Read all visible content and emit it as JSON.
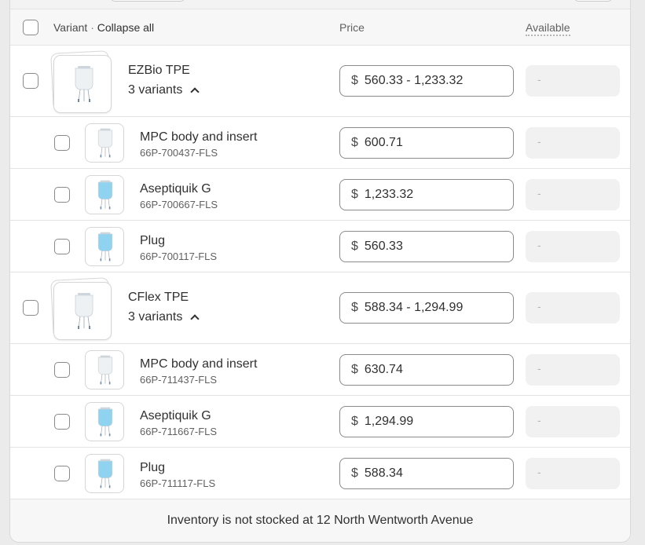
{
  "header": {
    "variant_label": "Variant",
    "separator": "·",
    "collapse_label": "Collapse all",
    "price_label": "Price",
    "available_label": "Available"
  },
  "groups": [
    {
      "name": "EZBio TPE",
      "variants_label": "3 variants",
      "price_currency": "$",
      "price_range": "560.33 - 1,233.32",
      "available": "-",
      "items": [
        {
          "name": "MPC body and insert",
          "sku": "66P-700437-FLS",
          "currency": "$",
          "price": "600.71",
          "available": "-",
          "image": "clear-bag-icon"
        },
        {
          "name": "Aseptiquik G",
          "sku": "66P-700667-FLS",
          "currency": "$",
          "price": "1,233.32",
          "available": "-",
          "image": "blue-bag-icon"
        },
        {
          "name": "Plug",
          "sku": "66P-700117-FLS",
          "currency": "$",
          "price": "560.33",
          "available": "-",
          "image": "blue-bag-icon"
        }
      ]
    },
    {
      "name": "CFlex TPE",
      "variants_label": "3 variants",
      "price_currency": "$",
      "price_range": "588.34 - 1,294.99",
      "available": "-",
      "items": [
        {
          "name": "MPC body and insert",
          "sku": "66P-711437-FLS",
          "currency": "$",
          "price": "630.74",
          "available": "-",
          "image": "clear-bag-icon"
        },
        {
          "name": "Aseptiquik G",
          "sku": "66P-711667-FLS",
          "currency": "$",
          "price": "1,294.99",
          "available": "-",
          "image": "blue-bag-icon"
        },
        {
          "name": "Plug",
          "sku": "66P-711117-FLS",
          "currency": "$",
          "price": "588.34",
          "available": "-",
          "image": "blue-bag-icon"
        }
      ]
    }
  ],
  "footer": {
    "message": "Inventory is not stocked at 12 North Wentworth Avenue"
  },
  "colors": {
    "clear_bag": "#eef1f4",
    "blue_bag": "#8fd3f0"
  }
}
